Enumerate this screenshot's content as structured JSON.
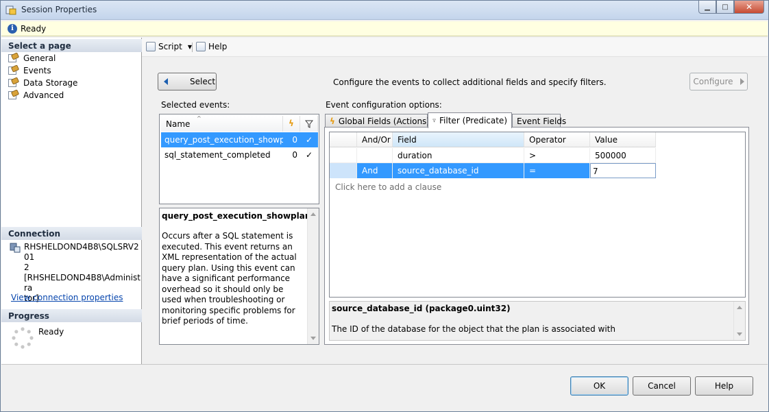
{
  "window": {
    "title": "Session Properties"
  },
  "status": {
    "text": "Ready"
  },
  "left_pane": {
    "select_page_header": "Select a page",
    "pages": [
      {
        "label": "General"
      },
      {
        "label": "Events"
      },
      {
        "label": "Data Storage"
      },
      {
        "label": "Advanced"
      }
    ],
    "connection_header": "Connection",
    "connection_text": "RHSHELDOND4B8\\SQLSRV2012\n[RHSHELDOND4B8\\Administrator]",
    "connection_line1": "RHSHELDOND4B8\\SQLSRV201",
    "connection_line2": "2",
    "connection_line3": "[RHSHELDOND4B8\\Administra",
    "connection_line4": "tor]",
    "view_connection_link": "View connection properties",
    "progress_header": "Progress",
    "progress_text": "Ready"
  },
  "toolbar": {
    "script_label": "Script",
    "help_label": "Help"
  },
  "main": {
    "select_button": "Select",
    "instruction": "Configure the events to collect additional fields and specify filters.",
    "configure_button": "Configure",
    "selected_events_label": "Selected events:",
    "event_config_label": "Event configuration options:",
    "events_table": {
      "name_header": "Name",
      "rows": [
        {
          "name": "query_post_execution_showplan",
          "actions": "0",
          "filter": "✓",
          "selected": true
        },
        {
          "name": "sql_statement_completed",
          "actions": "0",
          "filter": "✓",
          "selected": false
        }
      ]
    },
    "event_description": {
      "title": "query_post_execution_showplan",
      "body": "Occurs after a SQL statement is executed. This event returns an XML representation of the actual query plan. Using this event can have a significant performance overhead so it should only be used when troubleshooting or monitoring specific problems for brief periods of time."
    },
    "tabs": [
      {
        "label": "Global Fields (Actions)"
      },
      {
        "label": "Filter (Predicate)"
      },
      {
        "label": "Event Fields"
      }
    ],
    "filter_grid": {
      "headers": {
        "andor": "And/Or",
        "field": "Field",
        "operator": "Operator",
        "value": "Value"
      },
      "rows": [
        {
          "andor": "",
          "field": "duration",
          "operator": ">",
          "value": "500000"
        },
        {
          "andor": "And",
          "field": "source_database_id",
          "operator": "=",
          "value": "7"
        }
      ],
      "add_clause": "Click here to add a clause"
    },
    "field_description": {
      "title": "source_database_id (package0.uint32)",
      "body": "The ID of the database for the object that the plan is associated with"
    }
  },
  "buttons": {
    "ok": "OK",
    "cancel": "Cancel",
    "help": "Help"
  },
  "colors": {
    "selection": "#3399ff",
    "status_bg": "#ffffe1",
    "link": "#0645ad"
  }
}
